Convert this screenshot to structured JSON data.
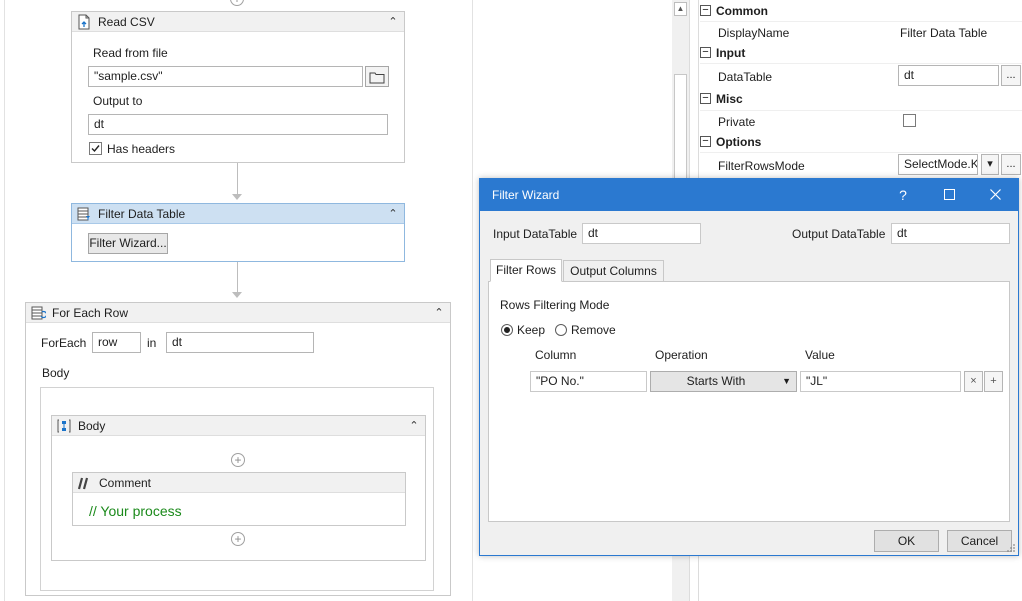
{
  "designer": {
    "read_csv": {
      "title": "Read CSV",
      "read_from_label": "Read from file",
      "file_value": "\"sample.csv\"",
      "output_label": "Output to",
      "output_value": "dt",
      "has_headers_label": "Has headers",
      "has_headers_checked": true
    },
    "filter_data_table": {
      "title": "Filter Data Table",
      "wizard_button": "Filter Wizard..."
    },
    "for_each_row": {
      "title": "For Each Row",
      "foreach_label": "ForEach",
      "item_value": "row",
      "in_label": "in",
      "collection_value": "dt",
      "body_label": "Body"
    },
    "body_sequence": {
      "title": "Body"
    },
    "comment": {
      "title": "Comment",
      "text": "// Your process"
    }
  },
  "properties": {
    "categories": [
      {
        "label": "Common",
        "rows": [
          {
            "name": "DisplayName",
            "value": "Filter Data Table"
          }
        ]
      },
      {
        "label": "Input",
        "rows": [
          {
            "name": "DataTable",
            "value": "dt"
          }
        ]
      },
      {
        "label": "Misc",
        "rows": [
          {
            "name": "Private",
            "value": ""
          }
        ]
      },
      {
        "label": "Options",
        "rows": [
          {
            "name": "FilterRowsMode",
            "value": "SelectMode.K"
          }
        ]
      }
    ],
    "ellipsis": "..."
  },
  "dialog": {
    "title": "Filter Wizard",
    "help": "?",
    "input_label": "Input DataTable",
    "input_value": "dt",
    "output_label": "Output DataTable",
    "output_value": "dt",
    "tabs": [
      "Filter Rows",
      "Output Columns"
    ],
    "mode_label": "Rows Filtering Mode",
    "keep_label": "Keep",
    "remove_label": "Remove",
    "columns": {
      "column": "Column",
      "operation": "Operation",
      "value": "Value"
    },
    "row": {
      "column": "\"PO No.\"",
      "operation": "Starts With",
      "value": "\"JL\""
    },
    "ok": "OK",
    "cancel": "Cancel"
  },
  "colors": {
    "accent": "#2b79d0",
    "selected_header": "#cde0f2",
    "comment_text": "#1b8a1b"
  }
}
